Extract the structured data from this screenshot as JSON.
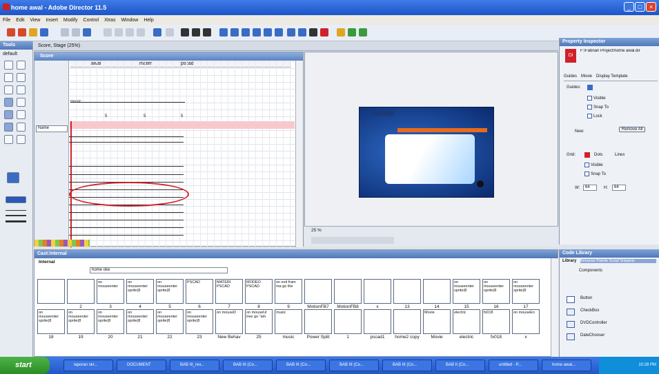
{
  "window": {
    "title": "home awal - Adobe Director 11.5"
  },
  "menu": [
    "File",
    "Edit",
    "View",
    "Insert",
    "Modify",
    "Control",
    "Xtras",
    "Window",
    "Help"
  ],
  "tools": {
    "title": "Tools",
    "mode": "default"
  },
  "stage_tab": "Score, Stage (25%)",
  "score": {
    "title": "Score",
    "markers": [
      "awal",
      "materi",
      "pscad"
    ],
    "channel_sound": "music",
    "frame_nums": [
      "5",
      "5",
      "5"
    ],
    "dropdown": "Name"
  },
  "stage": {
    "zoom": "25 %"
  },
  "property_inspector": {
    "title": "Property Inspector",
    "path": "F:\\Fabrian Project\\home awal.dir",
    "tabs": [
      "Guides",
      "Movie",
      "Display Template"
    ],
    "guides_label": "Guides:",
    "visible": "Visible",
    "snap_to": "Snap To",
    "lock": "Lock",
    "new_label": "New:",
    "remove_all": "Remove All",
    "grid_label": "Grid:",
    "dots": "Dots",
    "lines": "Lines",
    "grid_visible": "Visible",
    "grid_snap": "Snap To",
    "w_label": "W:",
    "w_value": "64",
    "h_label": "H:",
    "h_value": "64"
  },
  "cast": {
    "title": "Cast:Internal",
    "tab": "Internal",
    "cast_name": "home oke",
    "row1": [
      {
        "text": "",
        "num": ""
      },
      {
        "text": "",
        "num": "2"
      },
      {
        "text": "on mouseenter",
        "num": "3"
      },
      {
        "text": "on mouseenter sprite(8",
        "num": "4"
      },
      {
        "text": "on mouseenter sprite(8",
        "num": "5"
      },
      {
        "text": "PSCAD",
        "num": "6"
      },
      {
        "text": "MATERI PSCAD",
        "num": "7"
      },
      {
        "text": "MODEO PSCAD",
        "num": "8"
      },
      {
        "text": "on exit fram ma go the",
        "num": "9"
      },
      {
        "text": "",
        "num": "MotionFB7"
      },
      {
        "text": "",
        "num": "MotionFB8"
      },
      {
        "text": "",
        "num": "x"
      },
      {
        "text": "",
        "num": "13"
      },
      {
        "text": "",
        "num": "14"
      },
      {
        "text": "on mouseenter sprite(8",
        "num": "15"
      },
      {
        "text": "on mouseenter sprite(8",
        "num": "16"
      },
      {
        "text": "on mouseenter sprite(8",
        "num": "17"
      }
    ],
    "row2": [
      {
        "text": "on mouseenter sprite(8",
        "num": "18"
      },
      {
        "text": "on mouseenter sprite(8",
        "num": "19"
      },
      {
        "text": "on mouseenter sprite(8",
        "num": "20"
      },
      {
        "text": "on mouseenter sprite(8",
        "num": "21"
      },
      {
        "text": "on mouseenter sprite(8",
        "num": "22"
      },
      {
        "text": "on mouseenter sprite(8",
        "num": "23"
      },
      {
        "text": "on mouseD",
        "num": "New Behav"
      },
      {
        "text": "on mouseUr tree go \"am",
        "num": "25"
      },
      {
        "text": "music",
        "num": "music"
      },
      {
        "text": "",
        "num": "Power Split"
      },
      {
        "text": "",
        "num": "1"
      },
      {
        "text": "",
        "num": "pscad1"
      },
      {
        "text": "",
        "num": "home2 copy"
      },
      {
        "text": "Movie",
        "num": "Movie"
      },
      {
        "text": "electric",
        "num": "electric"
      },
      {
        "text": "fx018",
        "num": "fx018"
      },
      {
        "text": "on mouseEn",
        "num": "x"
      }
    ]
  },
  "code_library": {
    "title": "Code Library",
    "tab": "Library",
    "tab_other": "Behavior Palette  Script Snippets",
    "components": "Components",
    "items": [
      "Button",
      "CheckBox",
      "DVDController",
      "DateChooser"
    ]
  },
  "taskbar": {
    "start": "start",
    "tasks": [
      "laporan skr...",
      "DOCUMENT",
      "BAB III_rev...",
      "BAB III (Co...",
      "BAB III (Co...",
      "BAB III (Co...",
      "BAB III (Co...",
      "BAB II (Co...",
      "untitled - P...",
      "home awal..."
    ],
    "clock": "10:28 PM"
  },
  "colors": {
    "title_bar": "#1c55c7",
    "highlight_oval": "#d0212a",
    "stage_blue": "#0a2a6e"
  }
}
